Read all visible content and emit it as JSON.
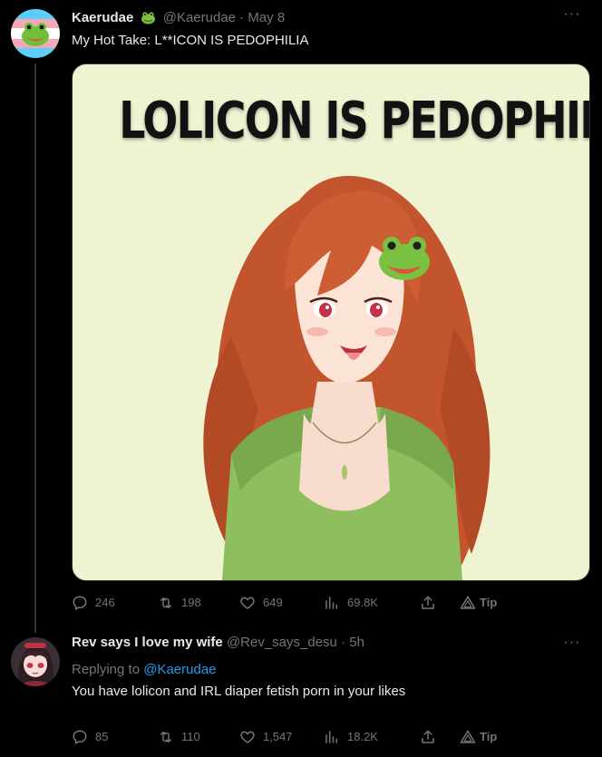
{
  "tweet1": {
    "display_name": "Kaerudae",
    "badge_icon": "frog-emoji-icon",
    "handle": "@Kaerudae",
    "separator": "·",
    "date": "May 8",
    "more_label": "···",
    "text": "My Hot Take: L**ICON IS PEDOPHILIA",
    "media": {
      "title": "LOLICON IS PEDOPHILIA",
      "description_icon": "frog-emoji-icon"
    },
    "actions": {
      "replies": "246",
      "retweets": "198",
      "likes": "649",
      "views": "69.8K",
      "tip": "Tip"
    }
  },
  "tweet2": {
    "display_name": "Rev says I love my wife",
    "handle": "@Rev_says_desu",
    "separator": "·",
    "date": "5h",
    "more_label": "···",
    "replying_label": "Replying to",
    "replying_to": "@Kaerudae",
    "text": "You have lolicon and IRL diaper fetish porn in your likes",
    "actions": {
      "replies": "85",
      "retweets": "110",
      "likes": "1,547",
      "views": "18.2K",
      "tip": "Tip"
    }
  },
  "colors": {
    "background": "#000000",
    "text_primary": "#e7e9ea",
    "text_secondary": "#71767b",
    "link": "#1d9bf0",
    "media_bg": "#eff3d2"
  }
}
